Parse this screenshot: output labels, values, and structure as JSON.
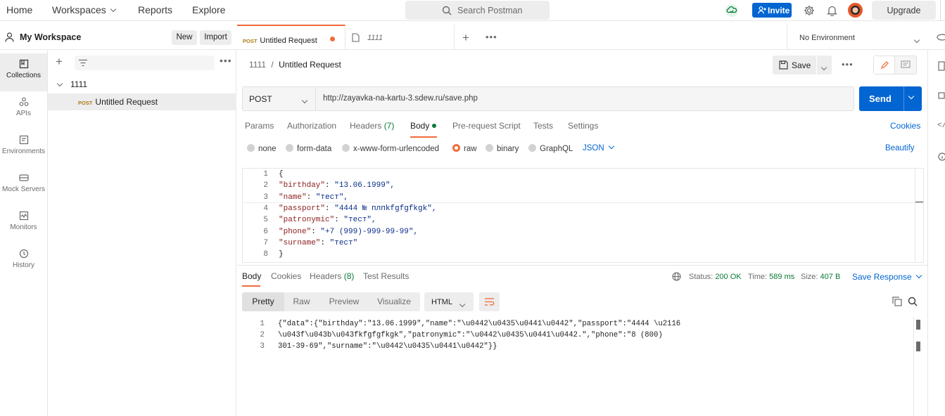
{
  "topbar": {
    "home": "Home",
    "workspaces": "Workspaces",
    "reports": "Reports",
    "explore": "Explore",
    "search_placeholder": "Search Postman",
    "invite": "Invite",
    "upgrade": "Upgrade"
  },
  "workspace": {
    "name": "My Workspace",
    "new": "New",
    "import": "Import"
  },
  "leftnav": [
    {
      "label": "Collections",
      "icon": "collections-icon",
      "active": true
    },
    {
      "label": "APIs",
      "icon": "apis-icon"
    },
    {
      "label": "Environments",
      "icon": "environments-icon"
    },
    {
      "label": "Mock Servers",
      "icon": "mock-servers-icon"
    },
    {
      "label": "Monitors",
      "icon": "monitors-icon"
    },
    {
      "label": "History",
      "icon": "history-icon"
    }
  ],
  "sidebar": {
    "collection": "1111",
    "request_method": "POST",
    "request_name": "Untitled Request"
  },
  "tabs": [
    {
      "method": "POST",
      "label": "Untitled Request",
      "active": true,
      "unsaved": true
    },
    {
      "label": "1111"
    }
  ],
  "environment": "No Environment",
  "breadcrumb": {
    "parent": "1111",
    "sep": "/",
    "current": "Untitled Request"
  },
  "save": "Save",
  "request": {
    "method": "POST",
    "url": "http://zayavka-na-kartu-3.sdew.ru/save.php",
    "send": "Send"
  },
  "request_tabs": {
    "params": "Params",
    "authorization": "Authorization",
    "headers": "Headers",
    "headers_count": "(7)",
    "body": "Body",
    "prerequest": "Pre-request Script",
    "tests": "Tests",
    "settings": "Settings",
    "cookies": "Cookies"
  },
  "body_types": {
    "none": "none",
    "form_data": "form-data",
    "urlencoded": "x-www-form-urlencoded",
    "raw": "raw",
    "binary": "binary",
    "graphql": "GraphQL",
    "format": "JSON",
    "beautify": "Beautify"
  },
  "body_lines": [
    {
      "n": "1",
      "text": "{"
    },
    {
      "n": "2",
      "key": "\"birthday\"",
      "val": "\"13.06.1999\","
    },
    {
      "n": "3",
      "key": "\"name\"",
      "val": "\"тест\","
    },
    {
      "n": "4",
      "key": "\"passport\"",
      "val": "\"4444 № плпkfgfgfkgk\","
    },
    {
      "n": "5",
      "key": "\"patronymic\"",
      "val": "\"тест\","
    },
    {
      "n": "6",
      "key": "\"phone\"",
      "val": "\"+7 (999)-999-99-99\","
    },
    {
      "n": "7",
      "key": "\"surname\"",
      "val": "\"тест\""
    },
    {
      "n": "8",
      "text": "}"
    }
  ],
  "response_tabs": {
    "body": "Body",
    "cookies": "Cookies",
    "headers": "Headers",
    "headers_count": "(8)",
    "test_results": "Test Results"
  },
  "response_meta": {
    "status_label": "Status:",
    "status": "200 OK",
    "time_label": "Time:",
    "time": "589 ms",
    "size_label": "Size:",
    "size": "407 B",
    "save_response": "Save Response"
  },
  "view_modes": {
    "pretty": "Pretty",
    "raw": "Raw",
    "preview": "Preview",
    "visualize": "Visualize",
    "format": "HTML"
  },
  "response_lines": [
    {
      "n": "1",
      "text": "{\"data\":{\"birthday\":\"13.06.1999\",\"name\":\"\\u0442\\u0435\\u0441\\u0442\",\"passport\":\"4444 \\u2116"
    },
    {
      "n": "2",
      "text": "\\u043f\\u043b\\u043fkfgfgfkgk\",\"patronymic\":\"\\u0442\\u0435\\u0441\\u0442.\",\"phone\":\"8 (800)"
    },
    {
      "n": "3",
      "text": "301-39-69\",\"surname\":\"\\u0442\\u0435\\u0441\\u0442\"}}"
    }
  ],
  "colors": {
    "accent": "#0265d2",
    "post": "#ab7c16",
    "unsaved_dot": "#f26b3a",
    "status_ok": "#0c7a3a"
  }
}
